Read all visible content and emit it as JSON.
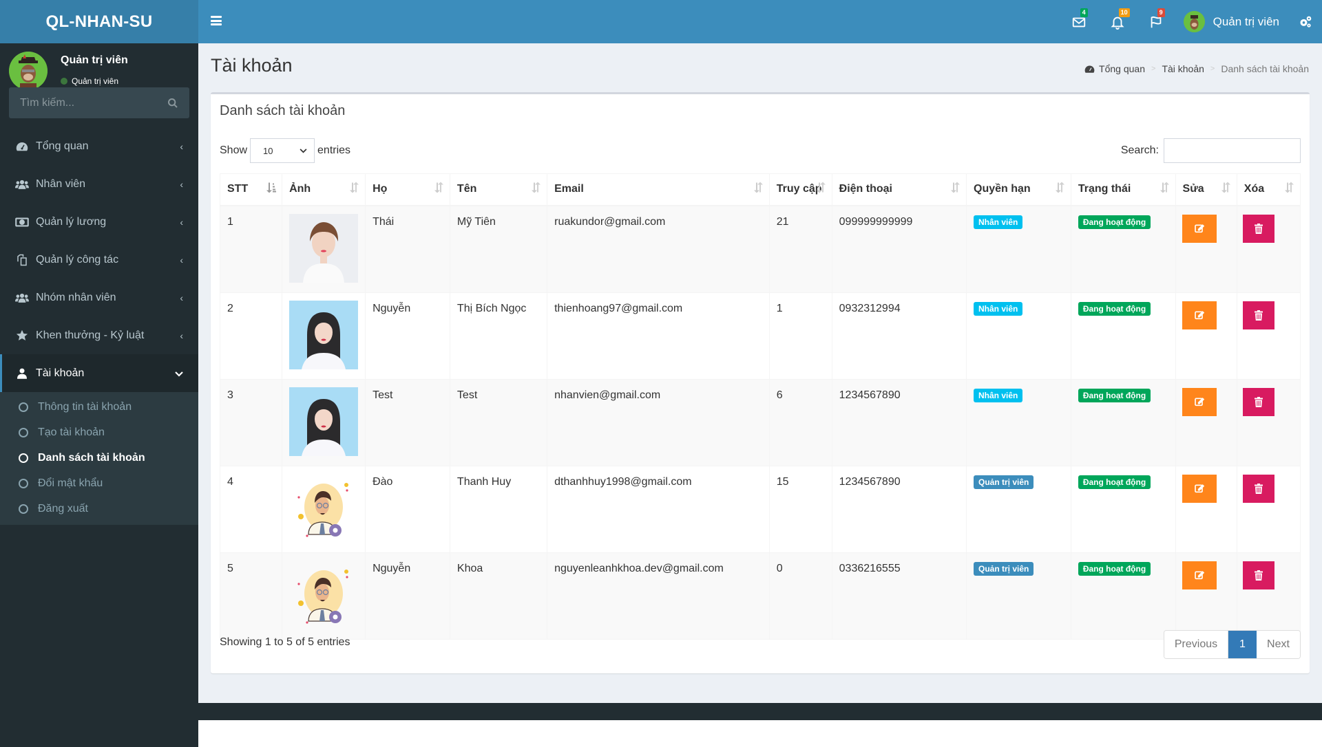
{
  "app": {
    "logo": "QL-NHAN-SU"
  },
  "topbar": {
    "messages_count": "4",
    "notifications_count": "10",
    "tasks_count": "9",
    "user_name": "Quản trị viên",
    "colors": {
      "header": "#3c8dbc",
      "logo": "#367fa9"
    }
  },
  "sidebar": {
    "user": {
      "name": "Quản trị viên",
      "status": "Quản trị viên"
    },
    "search_placeholder": "Tìm kiếm...",
    "items": [
      {
        "label": "Tổng quan",
        "icon": "dashboard-icon"
      },
      {
        "label": "Nhân viên",
        "icon": "users-icon"
      },
      {
        "label": "Quản lý lương",
        "icon": "money-icon"
      },
      {
        "label": "Quản lý công tác",
        "icon": "copy-icon"
      },
      {
        "label": "Nhóm nhân viên",
        "icon": "users-icon"
      },
      {
        "label": "Khen thưởng - Kỷ luật",
        "icon": "star-icon"
      },
      {
        "label": "Tài khoản",
        "icon": "user-icon",
        "active": true
      }
    ],
    "submenu": [
      {
        "label": "Thông tin tài khoản"
      },
      {
        "label": "Tạo tài khoản"
      },
      {
        "label": "Danh sách tài khoản",
        "current": true
      },
      {
        "label": "Đổi mật khẩu"
      },
      {
        "label": "Đăng xuất"
      }
    ]
  },
  "page": {
    "title": "Tài khoản",
    "breadcrumb": [
      "Tổng quan",
      "Tài khoản",
      "Danh sách tài khoản"
    ]
  },
  "box": {
    "title": "Danh sách tài khoản",
    "show_label": "Show",
    "entries_label": "entries",
    "page_length": "10",
    "search_label": "Search:",
    "search_value": ""
  },
  "table": {
    "columns": [
      "STT",
      "Ảnh",
      "Họ",
      "Tên",
      "Email",
      "Truy cập",
      "Điện thoại",
      "Quyền hạn",
      "Trạng thái",
      "Sửa",
      "Xóa"
    ],
    "rows": [
      {
        "stt": "1",
        "photo": "photo-woman-white-bg",
        "ho": "Thái",
        "ten": "Mỹ Tiên",
        "email": "ruakundor@gmail.com",
        "truy_cap": "21",
        "dien_thoai": "099999999999",
        "quyen_han": "Nhân viên",
        "trang_thai": "Đang hoạt động"
      },
      {
        "stt": "2",
        "photo": "photo-woman-blue-bg",
        "ho": "Nguyễn",
        "ten": "Thị Bích Ngọc",
        "email": "thienhoang97@gmail.com",
        "truy_cap": "1",
        "dien_thoai": "0932312994",
        "quyen_han": "Nhân viên",
        "trang_thai": "Đang hoạt động"
      },
      {
        "stt": "3",
        "photo": "photo-woman-blue-bg",
        "ho": "Test",
        "ten": "Test",
        "email": "nhanvien@gmail.com",
        "truy_cap": "6",
        "dien_thoai": "1234567890",
        "quyen_han": "Nhân viên",
        "trang_thai": "Đang hoạt động"
      },
      {
        "stt": "4",
        "photo": "admin-avatar-illustration",
        "ho": "Đào",
        "ten": "Thanh Huy",
        "email": "dthanhhuy1998@gmail.com",
        "truy_cap": "15",
        "dien_thoai": "1234567890",
        "quyen_han": "Quản trị viên",
        "trang_thai": "Đang hoạt động"
      },
      {
        "stt": "5",
        "photo": "admin-avatar-illustration",
        "ho": "Nguyễn",
        "ten": "Khoa",
        "email": "nguyenleanhkhoa.dev@gmail.com",
        "truy_cap": "0",
        "dien_thoai": "0336216555",
        "quyen_han": "Quản trị viên",
        "trang_thai": "Đang hoạt động"
      }
    ],
    "role_colors": {
      "Nhân viên": "#00c0ef",
      "Quản trị viên": "#3c8dbc"
    },
    "status_color": "#00a65a",
    "edit_color": "#ff851b",
    "delete_color": "#d81b60"
  },
  "footer": {
    "info": "Showing 1 to 5 of 5 entries",
    "prev": "Previous",
    "current_page": "1",
    "next": "Next"
  }
}
